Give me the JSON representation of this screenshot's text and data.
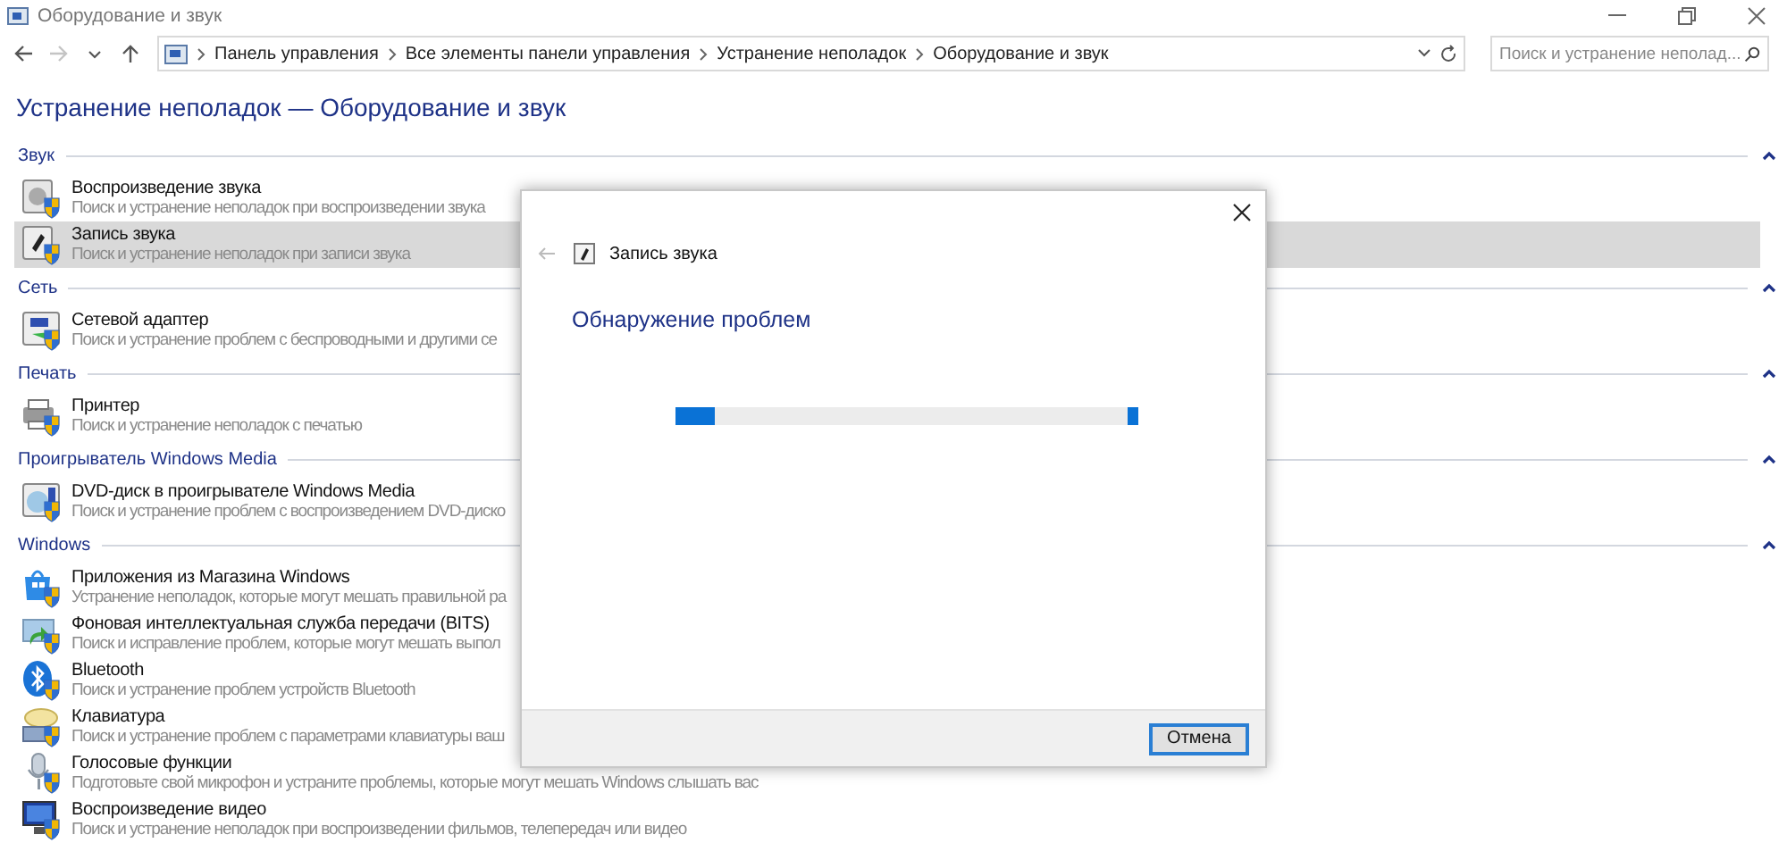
{
  "window": {
    "title": "Оборудование и звук"
  },
  "nav_buttons": [
    {
      "kind": "back",
      "disabled": false
    },
    {
      "kind": "forward",
      "disabled": true
    },
    {
      "kind": "recent",
      "disabled": false
    },
    {
      "kind": "up",
      "disabled": false
    }
  ],
  "breadcrumb": [
    "Панель управления",
    "Все элементы панели управления",
    "Устранение неполадок",
    "Оборудование и звук"
  ],
  "search": {
    "placeholder": "Поиск и устранение неполад..."
  },
  "heading": "Устранение неполадок — Оборудование и звук",
  "sections": [
    {
      "title": "Звук",
      "expanded": true,
      "items": [
        {
          "name": "Воспроизведение звука",
          "description": "Поиск и устранение неполадок при воспроизведении звука",
          "selected": false
        },
        {
          "name": "Запись звука",
          "description": "Поиск и устранение неполадок при записи звука",
          "selected": true
        }
      ]
    },
    {
      "title": "Сеть",
      "expanded": true,
      "items": [
        {
          "name": "Сетевой адаптер",
          "description": "Поиск и устранение проблем с беспроводными и другими се",
          "selected": false
        }
      ]
    },
    {
      "title": "Печать",
      "expanded": true,
      "items": [
        {
          "name": "Принтер",
          "description": "Поиск и устранение неполадок с печатью",
          "selected": false
        }
      ]
    },
    {
      "title": "Проигрыватель Windows Media",
      "expanded": true,
      "items": [
        {
          "name": "DVD-диск в проигрывателе Windows Media",
          "description": "Поиск и устранение проблем с воспроизведением DVD-диско",
          "selected": false
        }
      ]
    },
    {
      "title": "Windows",
      "expanded": true,
      "items": [
        {
          "name": "Приложения из Магазина Windows",
          "description": "Устранение неполадок, которые могут мешать правильной ра",
          "selected": false
        },
        {
          "name": "Фоновая интеллектуальная служба передачи (BITS)",
          "description": "Поиск и исправление проблем, которые могут мешать выпол",
          "selected": false
        },
        {
          "name": "Bluetooth",
          "description": "Поиск и устранение проблем устройств Bluetooth",
          "selected": false
        },
        {
          "name": "Клавиатура",
          "description": "Поиск и устранение проблем с параметрами клавиатуры ваш",
          "selected": false
        },
        {
          "name": "Голосовые функции",
          "description": "Подготовьте свой микрофон и устраните проблемы, которые могут мешать Windows слышать вас",
          "selected": false
        },
        {
          "name": "Воспроизведение видео",
          "description": "Поиск и устранение неполадок при воспроизведении фильмов, телепередач или видео",
          "selected": false
        }
      ]
    }
  ],
  "dialog": {
    "title": "Запись звука",
    "back_disabled": true,
    "heading": "Обнаружение проблем",
    "progress": {
      "level": 0.085
    },
    "buttons": [
      "Отмена"
    ]
  }
}
